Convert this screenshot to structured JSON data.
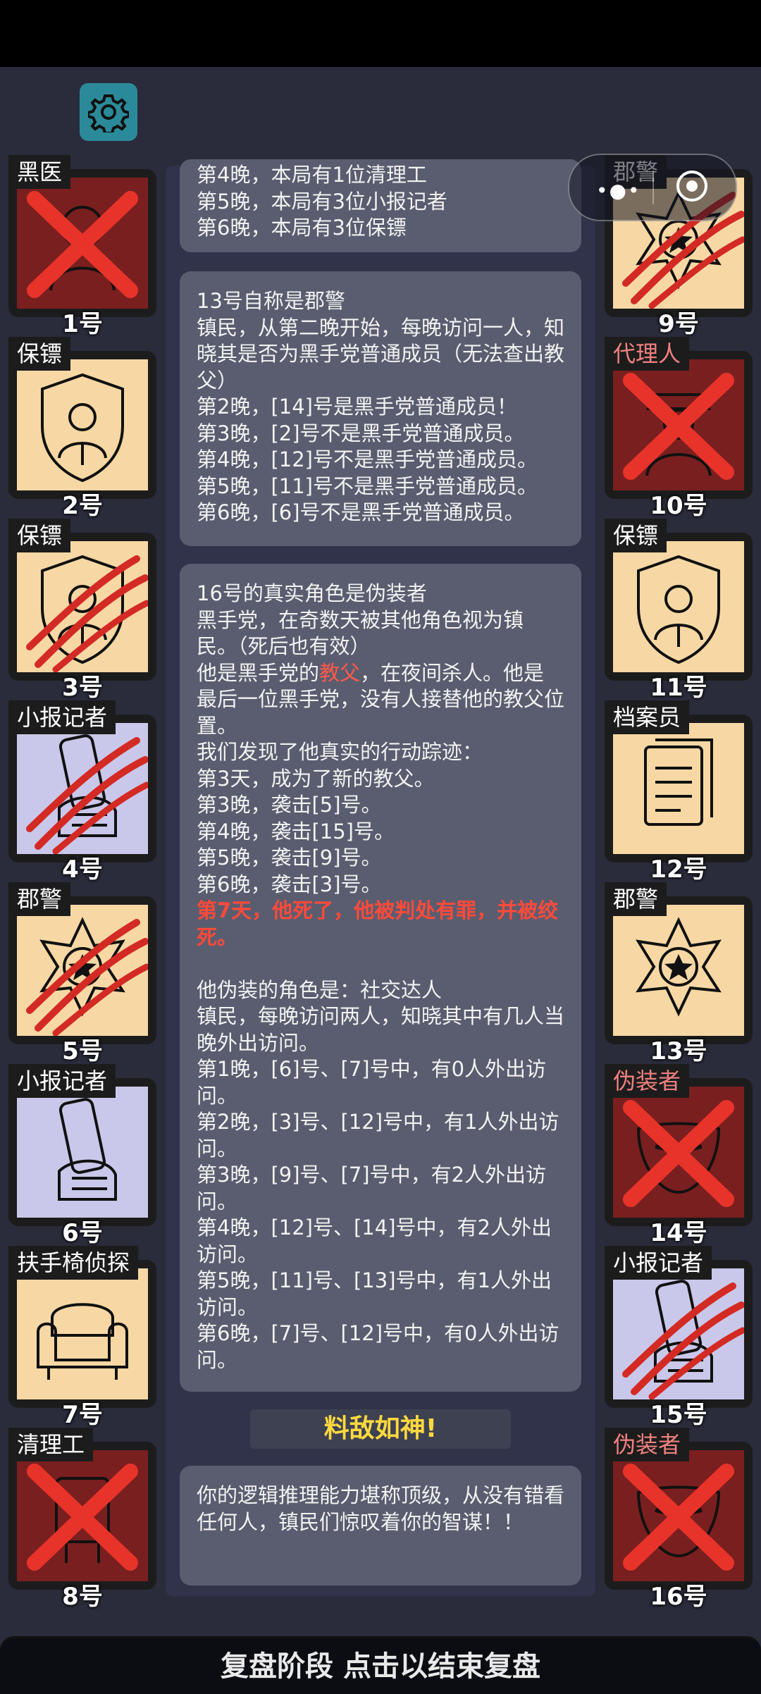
{
  "bottom_bar": {
    "label": "复盘阶段 点击以结束复盘"
  },
  "banner": {
    "label": "料敌如神!"
  },
  "players": [
    {
      "role": "黑医",
      "number": "1号",
      "status": "eliminated",
      "bg": "#7a1f1f",
      "icon": "doctor-icon"
    },
    {
      "role": "保镖",
      "number": "2号",
      "status": "alive",
      "bg": "#f7d8a4",
      "icon": "shield-person-icon"
    },
    {
      "role": "保镖",
      "number": "3号",
      "status": "killed",
      "bg": "#f7d8a4",
      "icon": "shield-person-icon"
    },
    {
      "role": "小报记者",
      "number": "4号",
      "status": "killed",
      "bg": "#c9c8ea",
      "icon": "newspaper-hand-icon"
    },
    {
      "role": "郡警",
      "number": "5号",
      "status": "killed",
      "bg": "#f7d8a4",
      "icon": "sheriff-badge-icon"
    },
    {
      "role": "小报记者",
      "number": "6号",
      "status": "alive",
      "bg": "#c9c8ea",
      "icon": "newspaper-hand-icon"
    },
    {
      "role": "扶手椅侦探",
      "number": "7号",
      "status": "alive",
      "bg": "#f7d8a4",
      "icon": "armchair-icon"
    },
    {
      "role": "清理工",
      "number": "8号",
      "status": "eliminated",
      "bg": "#7a1f1f",
      "icon": "cleaner-icon"
    },
    {
      "role": "郡警",
      "number": "9号",
      "status": "killed",
      "bg": "#f7d8a4",
      "icon": "sheriff-badge-icon"
    },
    {
      "role": "代理人",
      "number": "10号",
      "status": "eliminated",
      "bg": "#7a1f1f",
      "icon": "agent-icon"
    },
    {
      "role": "保镖",
      "number": "11号",
      "status": "alive",
      "bg": "#f7d8a4",
      "icon": "shield-person-icon"
    },
    {
      "role": "档案员",
      "number": "12号",
      "status": "alive",
      "bg": "#f7d8a4",
      "icon": "documents-icon"
    },
    {
      "role": "郡警",
      "number": "13号",
      "status": "alive",
      "bg": "#f7d8a4",
      "icon": "sheriff-badge-icon"
    },
    {
      "role": "伪装者",
      "number": "14号",
      "status": "eliminated",
      "bg": "#7a1f1f",
      "icon": "mask-icon"
    },
    {
      "role": "小报记者",
      "number": "15号",
      "status": "killed",
      "bg": "#c9c8ea",
      "icon": "newspaper-hand-icon"
    },
    {
      "role": "伪装者",
      "number": "16号",
      "status": "eliminated",
      "bg": "#7a1f1f",
      "icon": "mask-icon"
    }
  ],
  "messages": {
    "m1": {
      "lines": [
        "第4晚，本局有1位清理工",
        "第5晚，本局有3位小报记者",
        "第6晚，本局有3位保镖"
      ]
    },
    "m2": {
      "lines": [
        "13号自称是郡警",
        "镇民，从第二晚开始，每晚访问一人，知晓其是否为黑手党普通成员（无法查出教父）",
        "第2晚，[14]号是黑手党普通成员！",
        "第3晚，[2]号不是黑手党普通成员。",
        "第4晚，[12]号不是黑手党普通成员。",
        "第5晚，[11]号不是黑手党普通成员。",
        "第6晚，[6]号不是黑手党普通成员。"
      ]
    },
    "m3": {
      "line1": "16号的真实角色是伪装者",
      "line2": "黑手党，在奇数天被其他角色视为镇民。（死后也有效）",
      "line3_pre": "他是黑手党的",
      "line3_hl": "教父",
      "line3_post": "，在夜间杀人。他是最后一位黑手党，没有人接替他的教父位置。",
      "line4": "我们发现了他真实的行动踪迹：",
      "actions": [
        "第3天，成为了新的教父。",
        "第3晚，袭击[5]号。",
        "第4晚，袭击[15]号。",
        "第5晚，袭击[9]号。",
        "第6晚，袭击[3]号。"
      ],
      "death": "第7天，他死了，他被判处有罪，并被绞死。",
      "disguise_title": "他伪装的角色是：社交达人",
      "disguise_desc": "镇民，每晚访问两人，知晓其中有几人当晚外出访问。",
      "disguise_lines": [
        "第1晚，[6]号、[7]号中，有0人外出访问。",
        "第2晚，[3]号、[12]号中，有1人外出访问。",
        "第3晚，[9]号、[7]号中，有2人外出访问。",
        "第4晚，[12]号、[14]号中，有2人外出访问。",
        "第5晚，[11]号、[13]号中，有1人外出访问。",
        "第6晚，[7]号、[12]号中，有0人外出访问。"
      ]
    },
    "m4": {
      "text": "你的逻辑推理能力堪称顶级，从没有错看任何人，镇民们惊叹着你的智谋！！"
    }
  }
}
